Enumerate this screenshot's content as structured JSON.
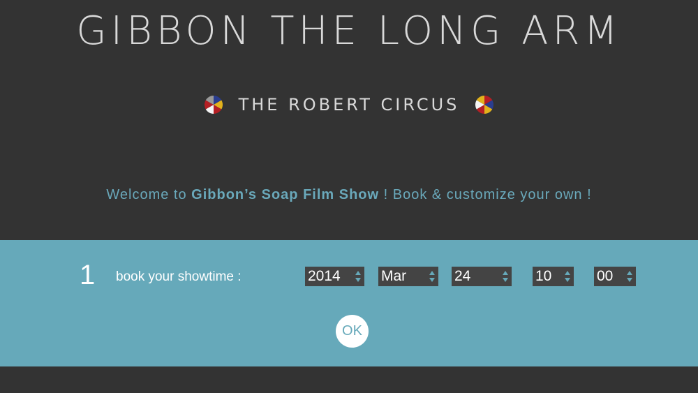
{
  "header": {
    "title": "GIBBON THE LONG ARM",
    "subtitle": "THE ROBERT CIRCUS"
  },
  "welcome": {
    "prefix": "Welcome to ",
    "show_name": "Gibbon’s Soap Film Show",
    "suffix": " ! Book & customize your own !"
  },
  "booking": {
    "step_number": "1",
    "step_label": "book your showtime :",
    "year": "2014",
    "month": "Mar",
    "day": "24",
    "hour": "10",
    "minute": "00",
    "ok_label": "OK"
  },
  "colors": {
    "background": "#333333",
    "band": "#66a9ba",
    "accent_text": "#6aa9bb",
    "select_bg": "#444444"
  },
  "icons": [
    "pinwheel-icon",
    "chevron-up-down-icon"
  ]
}
